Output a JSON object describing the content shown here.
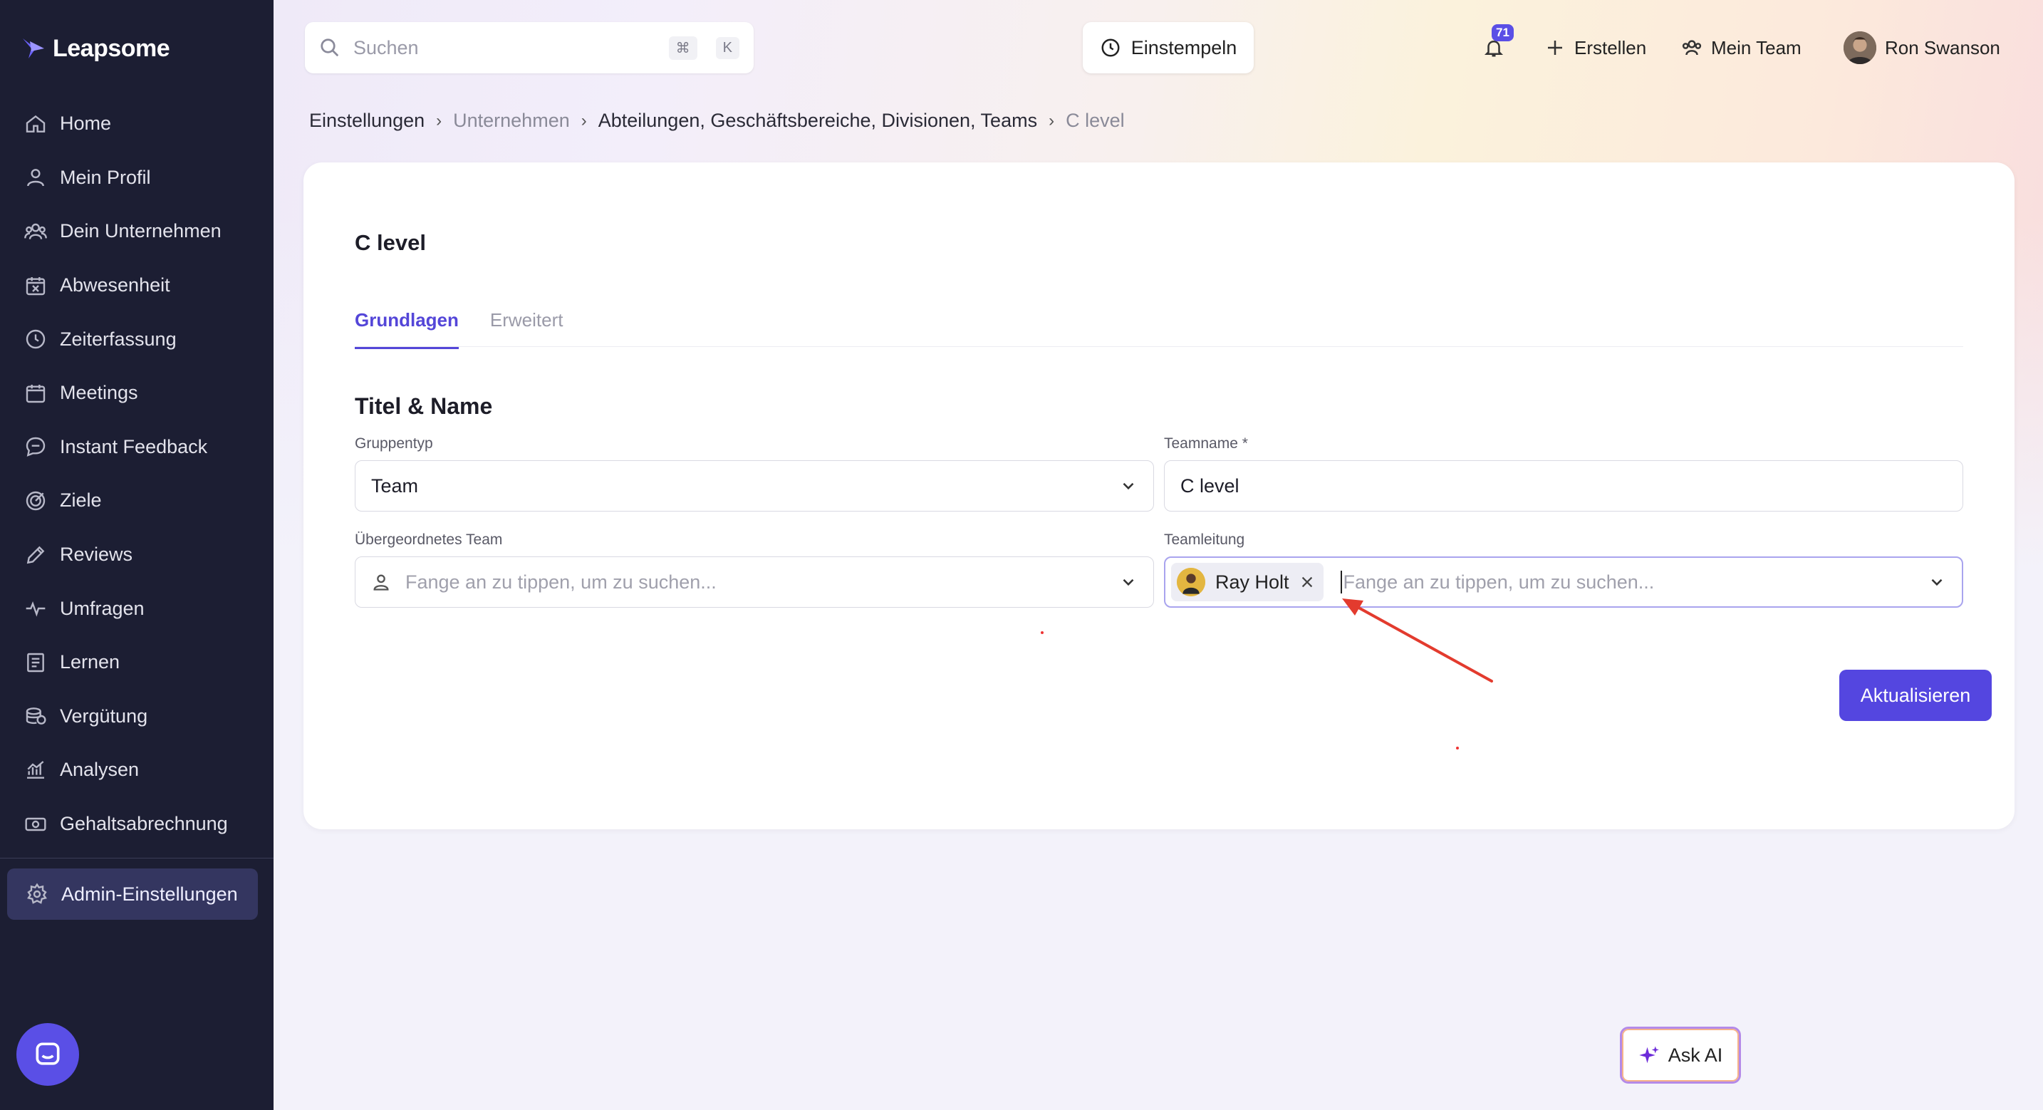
{
  "app": {
    "name": "Leapsome"
  },
  "sidebar": {
    "items": [
      {
        "label": "Home",
        "icon": "home-icon"
      },
      {
        "label": "Mein Profil",
        "icon": "user-icon"
      },
      {
        "label": "Dein Unternehmen",
        "icon": "users-icon"
      },
      {
        "label": "Abwesenheit",
        "icon": "calendar-x-icon"
      },
      {
        "label": "Zeiterfassung",
        "icon": "clock-icon"
      },
      {
        "label": "Meetings",
        "icon": "calendar-icon"
      },
      {
        "label": "Instant Feedback",
        "icon": "chat-icon"
      },
      {
        "label": "Ziele",
        "icon": "target-icon"
      },
      {
        "label": "Reviews",
        "icon": "pencil-icon"
      },
      {
        "label": "Umfragen",
        "icon": "pulse-icon"
      },
      {
        "label": "Lernen",
        "icon": "book-icon"
      },
      {
        "label": "Vergütung",
        "icon": "coins-icon"
      },
      {
        "label": "Analysen",
        "icon": "chart-icon"
      },
      {
        "label": "Gehaltsabrechnung",
        "icon": "money-icon"
      }
    ],
    "admin": {
      "label": "Admin-Einstellungen",
      "icon": "gear-icon"
    }
  },
  "header": {
    "search_placeholder": "Suchen",
    "shortcut_cmd": "⌘",
    "shortcut_key": "K",
    "clock_in": "Einstempeln",
    "notification_count": "71",
    "create": "Erstellen",
    "my_team": "Mein Team",
    "user_name": "Ron Swanson"
  },
  "breadcrumb": [
    "Einstellungen",
    "Unternehmen",
    "Abteilungen, Geschäftsbereiche, Divisionen, Teams",
    "C level"
  ],
  "page": {
    "title": "C level",
    "tabs": [
      "Grundlagen",
      "Erweitert"
    ],
    "section_title": "Titel & Name",
    "fields": {
      "group_type": {
        "label": "Gruppentyp",
        "value": "Team"
      },
      "team_name": {
        "label": "Teamname *",
        "value": "C level"
      },
      "parent_team": {
        "label": "Übergeordnetes Team",
        "placeholder": "Fange an zu tippen, um zu suchen..."
      },
      "team_lead": {
        "label": "Teamleitung",
        "chip": "Ray Holt",
        "placeholder": "Fange an zu tippen, um zu suchen..."
      }
    },
    "update_button": "Aktualisieren"
  },
  "ask_ai": "Ask AI",
  "colors": {
    "accent": "#5446e0",
    "sidebar": "#1c1e33",
    "annotation": "#e33b2e"
  }
}
